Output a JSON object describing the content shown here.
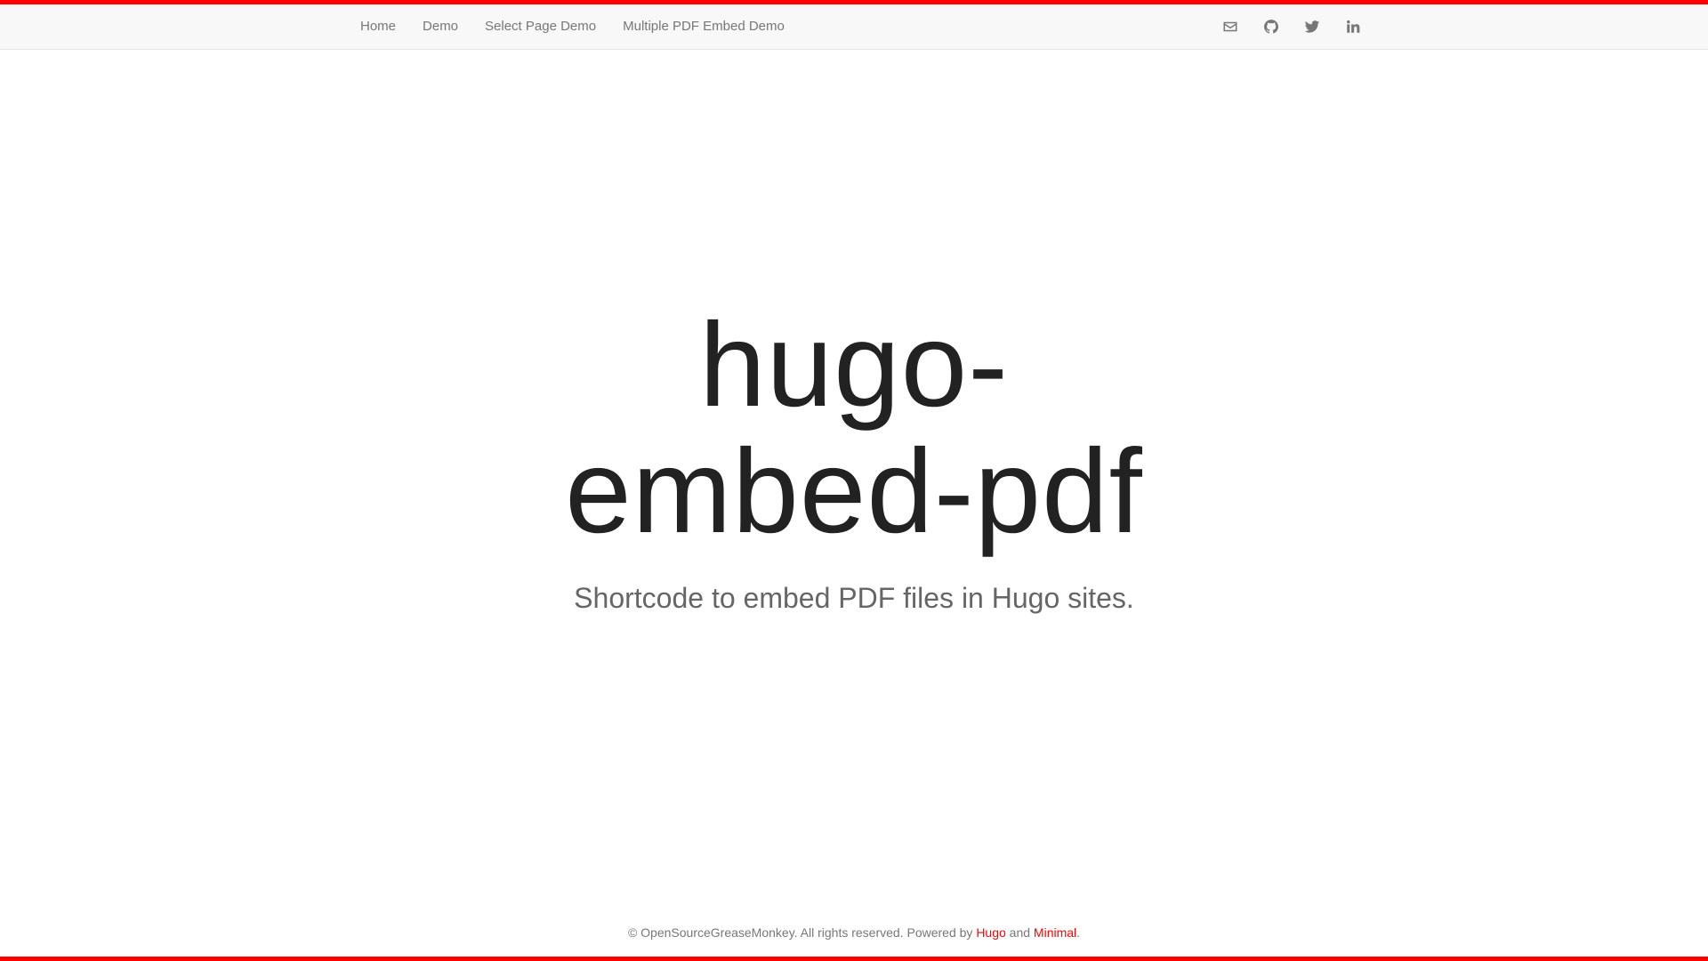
{
  "theme": {
    "accent": "#ff0000",
    "nav_bg": "#f8f8f8",
    "nav_text": "#777777",
    "title_color": "#222222"
  },
  "nav": {
    "links": [
      "Home",
      "Demo",
      "Select Page Demo",
      "Multiple PDF Embed Demo"
    ],
    "icons": [
      "envelope-icon",
      "github-icon",
      "twitter-icon",
      "linkedin-icon"
    ]
  },
  "hero": {
    "title": "hugo-embed-pdf",
    "subtitle": "Shortcode to embed PDF files in Hugo sites."
  },
  "footer": {
    "copyright": "© OpenSourceGreaseMonkey. All rights reserved. Powered by",
    "link_hugo": "Hugo",
    "and": "and",
    "link_minimal": "Minimal"
  }
}
